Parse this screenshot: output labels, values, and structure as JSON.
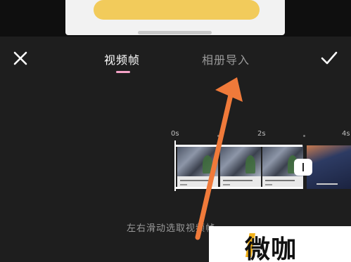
{
  "header": {
    "close_icon": "close-icon",
    "confirm_icon": "check-icon",
    "tabs": [
      {
        "label": "视频帧",
        "active": true
      },
      {
        "label": "相册导入",
        "active": false
      }
    ],
    "indicator_color": "#f5a3c7"
  },
  "timeline": {
    "ruler": [
      "0s",
      "2s",
      "4s"
    ],
    "frames": 4
  },
  "hint": "左右滑动选取视频帧",
  "annotation": {
    "arrow_color": "#f07a3a"
  },
  "watermark": {
    "text": "微咖",
    "accent": "#f2b21b"
  }
}
